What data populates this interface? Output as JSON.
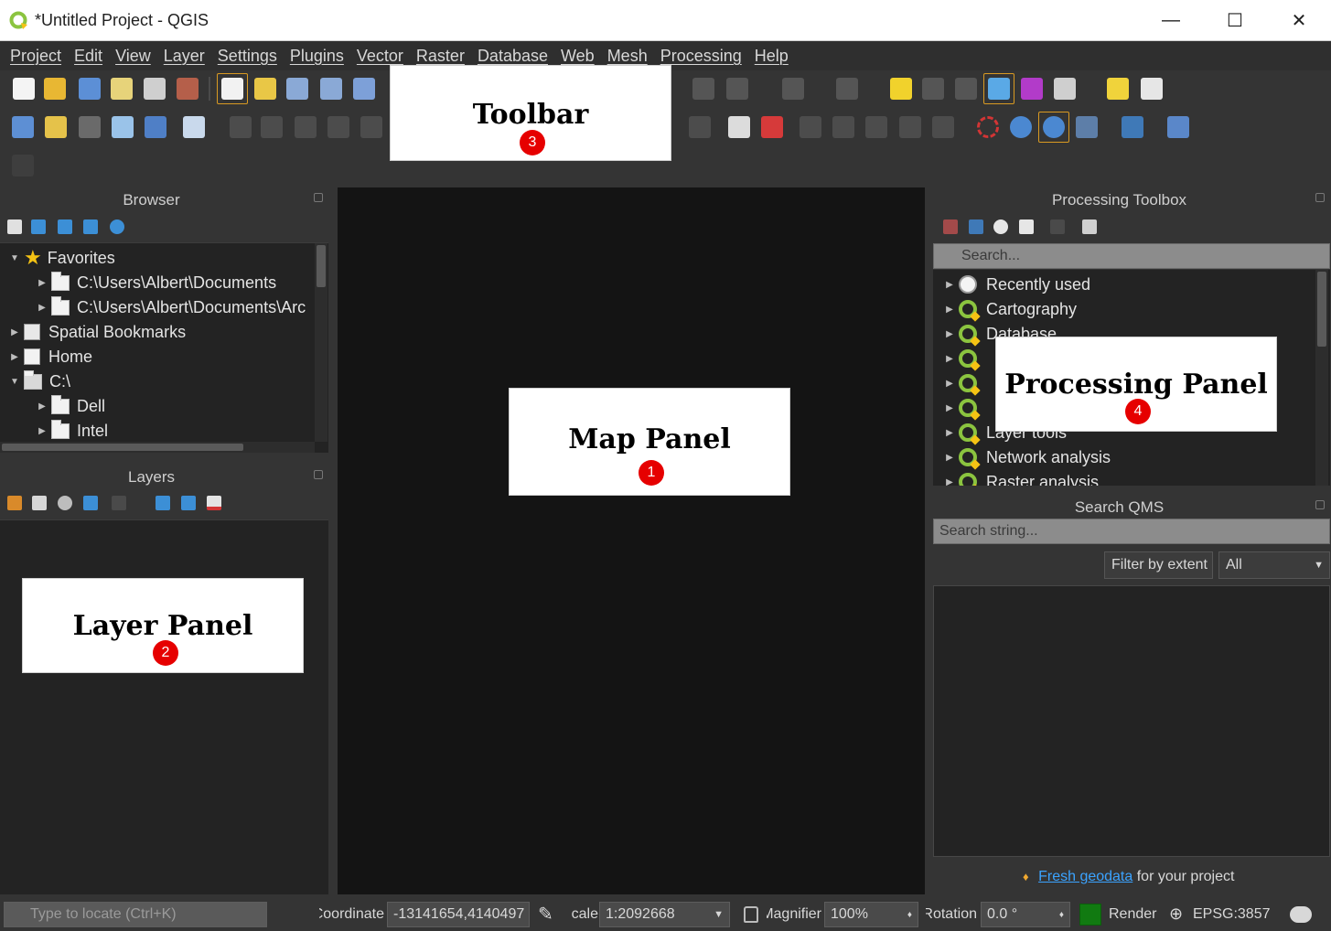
{
  "window": {
    "title": "*Untitled Project - QGIS",
    "minimize": "—",
    "maximize": "☐",
    "close": "✕"
  },
  "menubar": {
    "items": [
      "Project",
      "Edit",
      "View",
      "Layer",
      "Settings",
      "Plugins",
      "Vector",
      "Raster",
      "Database",
      "Web",
      "Mesh",
      "Processing",
      "Help"
    ]
  },
  "browser": {
    "title": "Browser",
    "tree": [
      {
        "label": "Favorites",
        "arrow": "▼"
      },
      {
        "label": "C:\\Users\\Albert\\Documents",
        "arrow": "▶"
      },
      {
        "label": "C:\\Users\\Albert\\Documents\\Arc",
        "arrow": "▶"
      },
      {
        "label": "Spatial Bookmarks",
        "arrow": "▶"
      },
      {
        "label": "Home",
        "arrow": "▶"
      },
      {
        "label": "C:\\",
        "arrow": "▼"
      },
      {
        "label": "Dell",
        "arrow": "▶"
      },
      {
        "label": "Intel",
        "arrow": "▶"
      }
    ]
  },
  "layers": {
    "title": "Layers"
  },
  "processing": {
    "title": "Processing Toolbox",
    "search_placeholder": "Search...",
    "items": [
      {
        "label": "Recently used",
        "arrow": "▶"
      },
      {
        "label": "Cartography",
        "arrow": "▶"
      },
      {
        "label": "Database",
        "arrow": "▶"
      },
      {
        "label": "",
        "arrow": "▶"
      },
      {
        "label": "",
        "arrow": "▶"
      },
      {
        "label": "",
        "arrow": "▶"
      },
      {
        "label": "Layer tools",
        "arrow": "▶"
      },
      {
        "label": "Network analysis",
        "arrow": "▶"
      },
      {
        "label": "Raster analysis",
        "arrow": "▶"
      }
    ]
  },
  "qms": {
    "title": "Search QMS",
    "search_placeholder": "Search string...",
    "filter_button": "Filter by extent",
    "filter_select": "All",
    "footer_link": "Fresh geodata",
    "footer_text": "for your project"
  },
  "annotations": {
    "map": {
      "label": "Map Panel",
      "number": "1"
    },
    "layer": {
      "label": "Layer Panel",
      "number": "2"
    },
    "toolbar": {
      "label": "Toolbar",
      "number": "3"
    },
    "processing": {
      "label": "Processing Panel",
      "number": "4"
    }
  },
  "statusbar": {
    "locator_placeholder": "Type to locate (Ctrl+K)",
    "coordinate_label": "Coordinate",
    "coordinate_value": "-13141654,4140497",
    "scale_label": "Scale",
    "scale_value": "1:2092668",
    "magnifier_label": "Magnifier",
    "magnifier_value": "100%",
    "rotation_label": "Rotation",
    "rotation_value": "0.0 °",
    "render_label": "Render",
    "crs": "EPSG:3857"
  },
  "colors": {
    "accent_orange": "#d99a22",
    "render_green": "#117a11",
    "badge_red": "#e60000",
    "link_blue": "#3ba3ff"
  }
}
